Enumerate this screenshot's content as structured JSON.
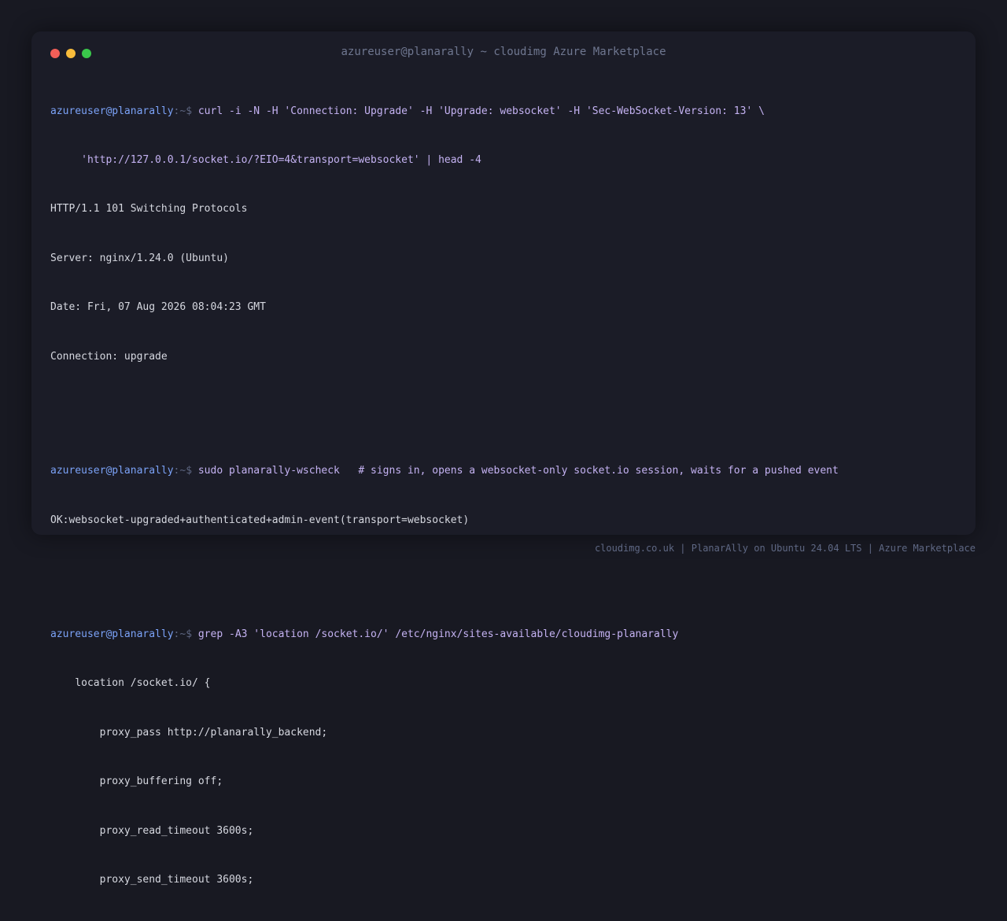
{
  "window": {
    "title": "azureuser@planarally ~ cloudimg Azure Marketplace"
  },
  "prompt": {
    "user_host": "azureuser@planarally",
    "path_symbol": ":~$ "
  },
  "terminal": {
    "cmd1": "curl -i -N -H 'Connection: Upgrade' -H 'Upgrade: websocket' -H 'Sec-WebSocket-Version: 13' \\",
    "cmd1_cont": "     'http://127.0.0.1/socket.io/?EIO=4&transport=websocket' | head -4",
    "out1": [
      "HTTP/1.1 101 Switching Protocols",
      "Server: nginx/1.24.0 (Ubuntu)",
      "Date: Fri, 07 Aug 2026 08:04:23 GMT",
      "Connection: upgrade"
    ],
    "cmd2": "sudo planarally-wscheck   # signs in, opens a websocket-only socket.io session, waits for a pushed event",
    "out2": [
      "OK:websocket-upgraded+authenticated+admin-event(transport=websocket)"
    ],
    "cmd3": "grep -A3 'location /socket.io/' /etc/nginx/sites-available/cloudimg-planarally",
    "out3": [
      "    location /socket.io/ {",
      "        proxy_pass http://planarally_backend;",
      "        proxy_buffering off;",
      "        proxy_read_timeout 3600s;",
      "        proxy_send_timeout 3600s;"
    ]
  },
  "footer": {
    "text": "cloudimg.co.uk | PlanarAlly on Ubuntu 24.04 LTS | Azure Marketplace"
  },
  "colors": {
    "background": "#181922",
    "window": "#1b1c27",
    "prompt_user": "#7ba2f7",
    "command": "#c4b2f2",
    "output": "#d6d8e0",
    "close": "#f25f58",
    "minimize": "#f8bc3b",
    "maximize": "#3ac74b"
  }
}
